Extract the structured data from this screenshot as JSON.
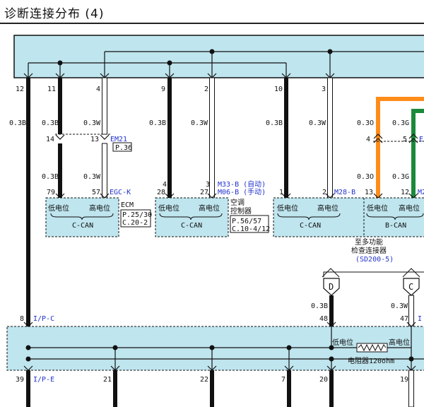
{
  "title": "诊断连接分布 (4)",
  "colors": {
    "module_fill": "#bfe5ee",
    "wire_black": "#111111",
    "wire_orange": "#ff8c1a",
    "wire_green": "#1a8a3a",
    "connector_link": "#2233cc"
  },
  "top_pins": {
    "p12": "12",
    "p11": "11",
    "p4": "4",
    "p9": "9",
    "p2": "2",
    "p10": "10",
    "p3": "3"
  },
  "wire_specs": {
    "b1": "0.3B",
    "b2": "0.3B",
    "w1": "0.3W",
    "b3": "0.3B",
    "w2": "0.3W",
    "b4": "0.3B",
    "w3": "0.3W",
    "o1": "0.3O",
    "g1": "0.3G"
  },
  "mid_connectors": {
    "em21_pin14": "14",
    "em21_pin13": "13",
    "em21": "EM21",
    "em21_ref": "P.36",
    "orange_pin": "4",
    "green_pin": "5",
    "green_code": "E"
  },
  "lower_specs": {
    "b1": "0.3B",
    "w1": "0.3W",
    "o1": "0.3O",
    "g1": "0.3G"
  },
  "lower_pins": {
    "p79": "79",
    "p57": "57",
    "p28": "28",
    "p27": "27",
    "p4": "4",
    "p3": "3",
    "p1": "1",
    "p2": "2",
    "p13": "13",
    "p12": "12"
  },
  "codes": {
    "egc_k": "EGC-K",
    "m33_b": "M33-B (自动)",
    "m06_b": "M06-B (手动)",
    "m28_b": "M28-B",
    "m2": "M2"
  },
  "modules": {
    "can_low": "低电位",
    "can_high": "高电位",
    "c_can": "C-CAN",
    "b_can": "B-CAN",
    "ecm": "ECM",
    "ecm_ref1": "P.25/30",
    "ecm_ref2": "C.20-2",
    "ac_line1": "空调",
    "ac_line2": "控制器",
    "ac_ref1": "P.56/57",
    "ac_ref2": "C.10-4/12"
  },
  "dlc": {
    "line1": "至多功能",
    "line2": "检查连接器",
    "line3": "(SD200-5)",
    "term_d": "D",
    "term_c": "C",
    "spec_d": "0.3B",
    "spec_c": "0.3W",
    "pin_d": "48",
    "pin_c": "47",
    "code_c": "I"
  },
  "junction": {
    "pin8": "8",
    "ipc": "I/P-C",
    "pin39": "39",
    "ipe": "I/P-E",
    "pin21": "21",
    "pin22": "22",
    "pin7": "7",
    "pin20": "20",
    "pin19": "19",
    "low": "低电位",
    "high": "高电位",
    "resistor": "电阻器120ohm"
  }
}
